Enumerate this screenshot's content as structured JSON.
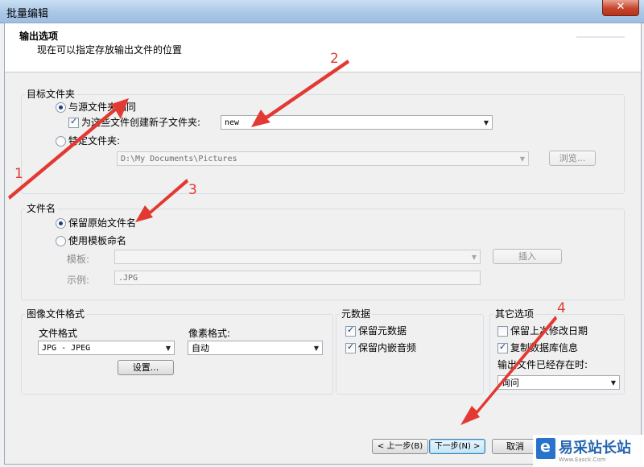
{
  "window": {
    "title": "批量编辑",
    "close_symbol": "✕"
  },
  "header": {
    "title": "输出选项",
    "subtitle": "现在可以指定存放输出文件的位置"
  },
  "target_folder": {
    "group_title": "目标文件夹",
    "same_as_source_label": "与源文件夹相同",
    "create_subfolder_label": "为这些文件创建新子文件夹:",
    "subfolder_value": "new",
    "specific_folder_label": "特定文件夹:",
    "specific_folder_value": "D:\\My Documents\\Pictures",
    "browse_label": "浏览..."
  },
  "file_name": {
    "group_title": "文件名",
    "keep_original_label": "保留原始文件名",
    "use_template_label": "使用模板命名",
    "template_label": "模板:",
    "insert_label": "插入",
    "example_label": "示例:",
    "example_value": ".JPG"
  },
  "image_format": {
    "group_title": "图像文件格式",
    "file_format_label": "文件格式",
    "file_format_value": "JPG - JPEG",
    "pixel_format_label": "像素格式:",
    "pixel_format_value": "自动",
    "settings_label": "设置..."
  },
  "metadata": {
    "group_title": "元数据",
    "keep_metadata_label": "保留元数据",
    "keep_embedded_audio_label": "保留内嵌音频"
  },
  "other_options": {
    "group_title": "其它选项",
    "keep_last_modified_label": "保留上次修改日期",
    "copy_db_info_label": "复制数据库信息",
    "output_exists_label": "输出文件已经存在时:",
    "output_exists_value": "询问"
  },
  "footer": {
    "back_label": "< 上一步(B)",
    "next_label": "下一步(N) >",
    "cancel_label": "取消"
  },
  "annotations": {
    "n1": "1",
    "n2": "2",
    "n3": "3",
    "n4": "4"
  },
  "watermark": {
    "text": "易采站长站",
    "url": "Www.Easck.Com"
  },
  "colors": {
    "annotation_red": "#e23a33",
    "title_bar": "#a9c6e6",
    "focus_blue": "#3c7fb1"
  }
}
